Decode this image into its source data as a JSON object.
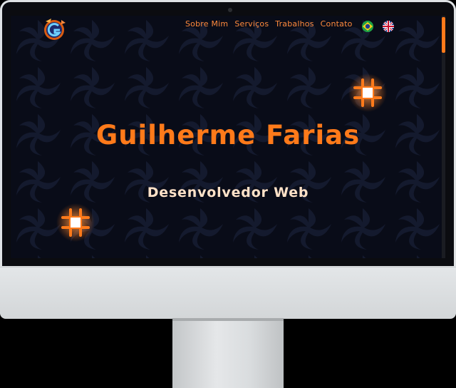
{
  "colors": {
    "accent": "#ff7a1a",
    "subtitle": "#ffe2c8",
    "background": "#0a0d1a",
    "pattern": "#161d33",
    "monitor": "#dfe2e4"
  },
  "logo": {
    "icon": "g-logo-icon"
  },
  "nav": {
    "items": [
      {
        "label": "Sobre Mim"
      },
      {
        "label": "Serviços"
      },
      {
        "label": "Trabalhos"
      },
      {
        "label": "Contato"
      }
    ]
  },
  "languages": [
    {
      "icon": "brazil-flag-icon"
    },
    {
      "icon": "uk-flag-icon"
    }
  ],
  "hero": {
    "title": "Guilherme Farias",
    "subtitle": "Desenvolvedor Web"
  },
  "decorations": [
    {
      "icon": "hash-glow-icon"
    },
    {
      "icon": "hash-glow-icon"
    }
  ]
}
